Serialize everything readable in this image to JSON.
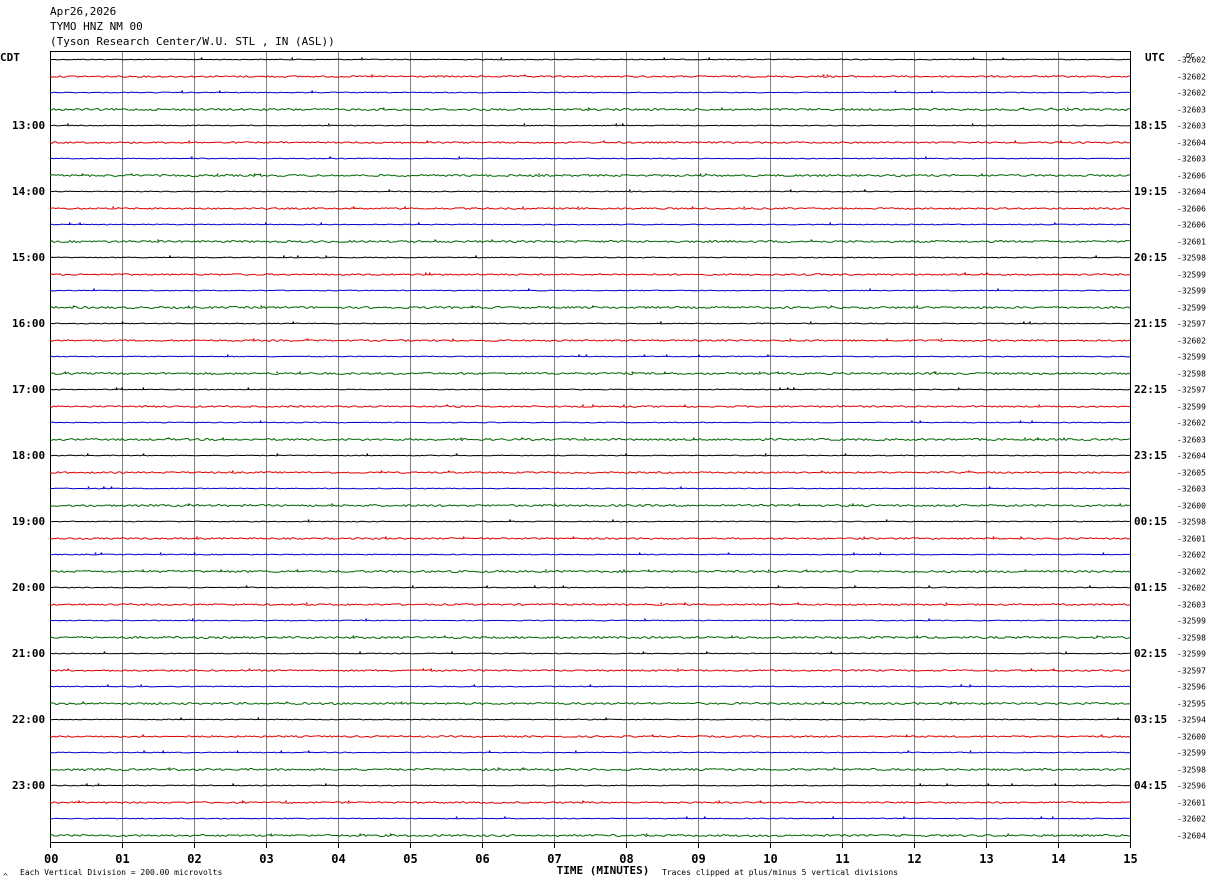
{
  "header": {
    "date": "Apr26,2026",
    "station": "TYMO HNZ NM 00",
    "location": "(Tyson Research Center/W.U. STL , IN (ASL))"
  },
  "left_axis_label": "CDT",
  "right_axis_label": "UTC",
  "dc_label": "DC",
  "footer": {
    "scale_note": "Each Vertical Division =  200.00 microvolts",
    "clip_note": "Traces clipped at plus/minus 5 vertical divisions",
    "corner_mark": "^"
  },
  "colors": {
    "trace_black": "#000000",
    "trace_red": "#dd0000",
    "trace_blue": "#0000cc",
    "trace_green": "#006600",
    "grid_minute": "#808080"
  },
  "chart_data": {
    "type": "line",
    "xlabel": "TIME (MINUTES)",
    "x_ticks": [
      "00",
      "01",
      "02",
      "03",
      "04",
      "05",
      "06",
      "07",
      "08",
      "09",
      "10",
      "11",
      "12",
      "13",
      "14",
      "15"
    ],
    "xlim": [
      0,
      15
    ],
    "trace_colors_cycle": [
      "black",
      "red",
      "blue",
      "green"
    ],
    "left_time_labels": [
      "13:00",
      "14:00",
      "15:00",
      "16:00",
      "17:00",
      "18:00",
      "19:00",
      "20:00",
      "21:00",
      "22:00",
      "23:00"
    ],
    "right_time_labels": [
      "18:15",
      "19:15",
      "20:15",
      "21:15",
      "22:15",
      "23:15",
      "00:15",
      "01:15",
      "02:15",
      "03:15",
      "04:15"
    ],
    "dc_offsets": [
      "-32602",
      "-32602",
      "-32602",
      "-32603",
      "-32603",
      "-32604",
      "-32603",
      "-32606",
      "-32604",
      "-32606",
      "-32606",
      "-32601",
      "-32598",
      "-32599",
      "-32599",
      "-32599",
      "-32597",
      "-32602",
      "-32599",
      "-32598",
      "-32597",
      "-32599",
      "-32602",
      "-32603",
      "-32604",
      "-32605",
      "-32603",
      "-32600",
      "-32598",
      "-32601",
      "-32602",
      "-32602",
      "-32602",
      "-32603",
      "-32599",
      "-32598",
      "-32599",
      "-32597",
      "-32596",
      "-32595",
      "-32594",
      "-32600",
      "-32599",
      "-32598",
      "-32596",
      "-32601",
      "-32602",
      "-32604"
    ]
  }
}
